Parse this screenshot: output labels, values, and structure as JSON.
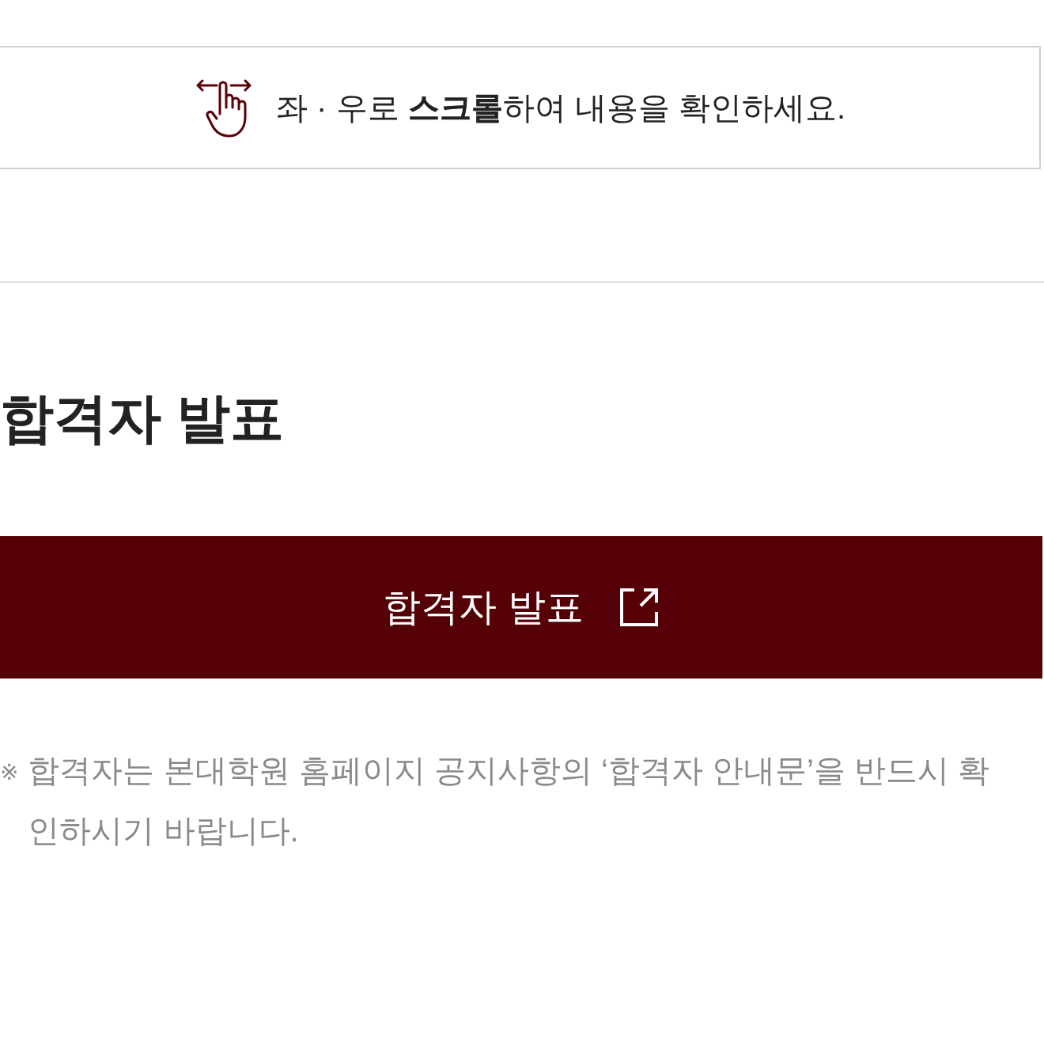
{
  "scroll_hint": {
    "text": "좌 · 우로 **스크롤**하여 내용을 확인하세요."
  },
  "section": {
    "title": "합격자 발표"
  },
  "link_button": {
    "label": "합격자 발표"
  },
  "note": {
    "mark": "※",
    "text": "합격자는 본대학원 홈페이지 공지사항의 ‘합격자 안내문’을 반드시 확인하시기 바랍니다."
  }
}
